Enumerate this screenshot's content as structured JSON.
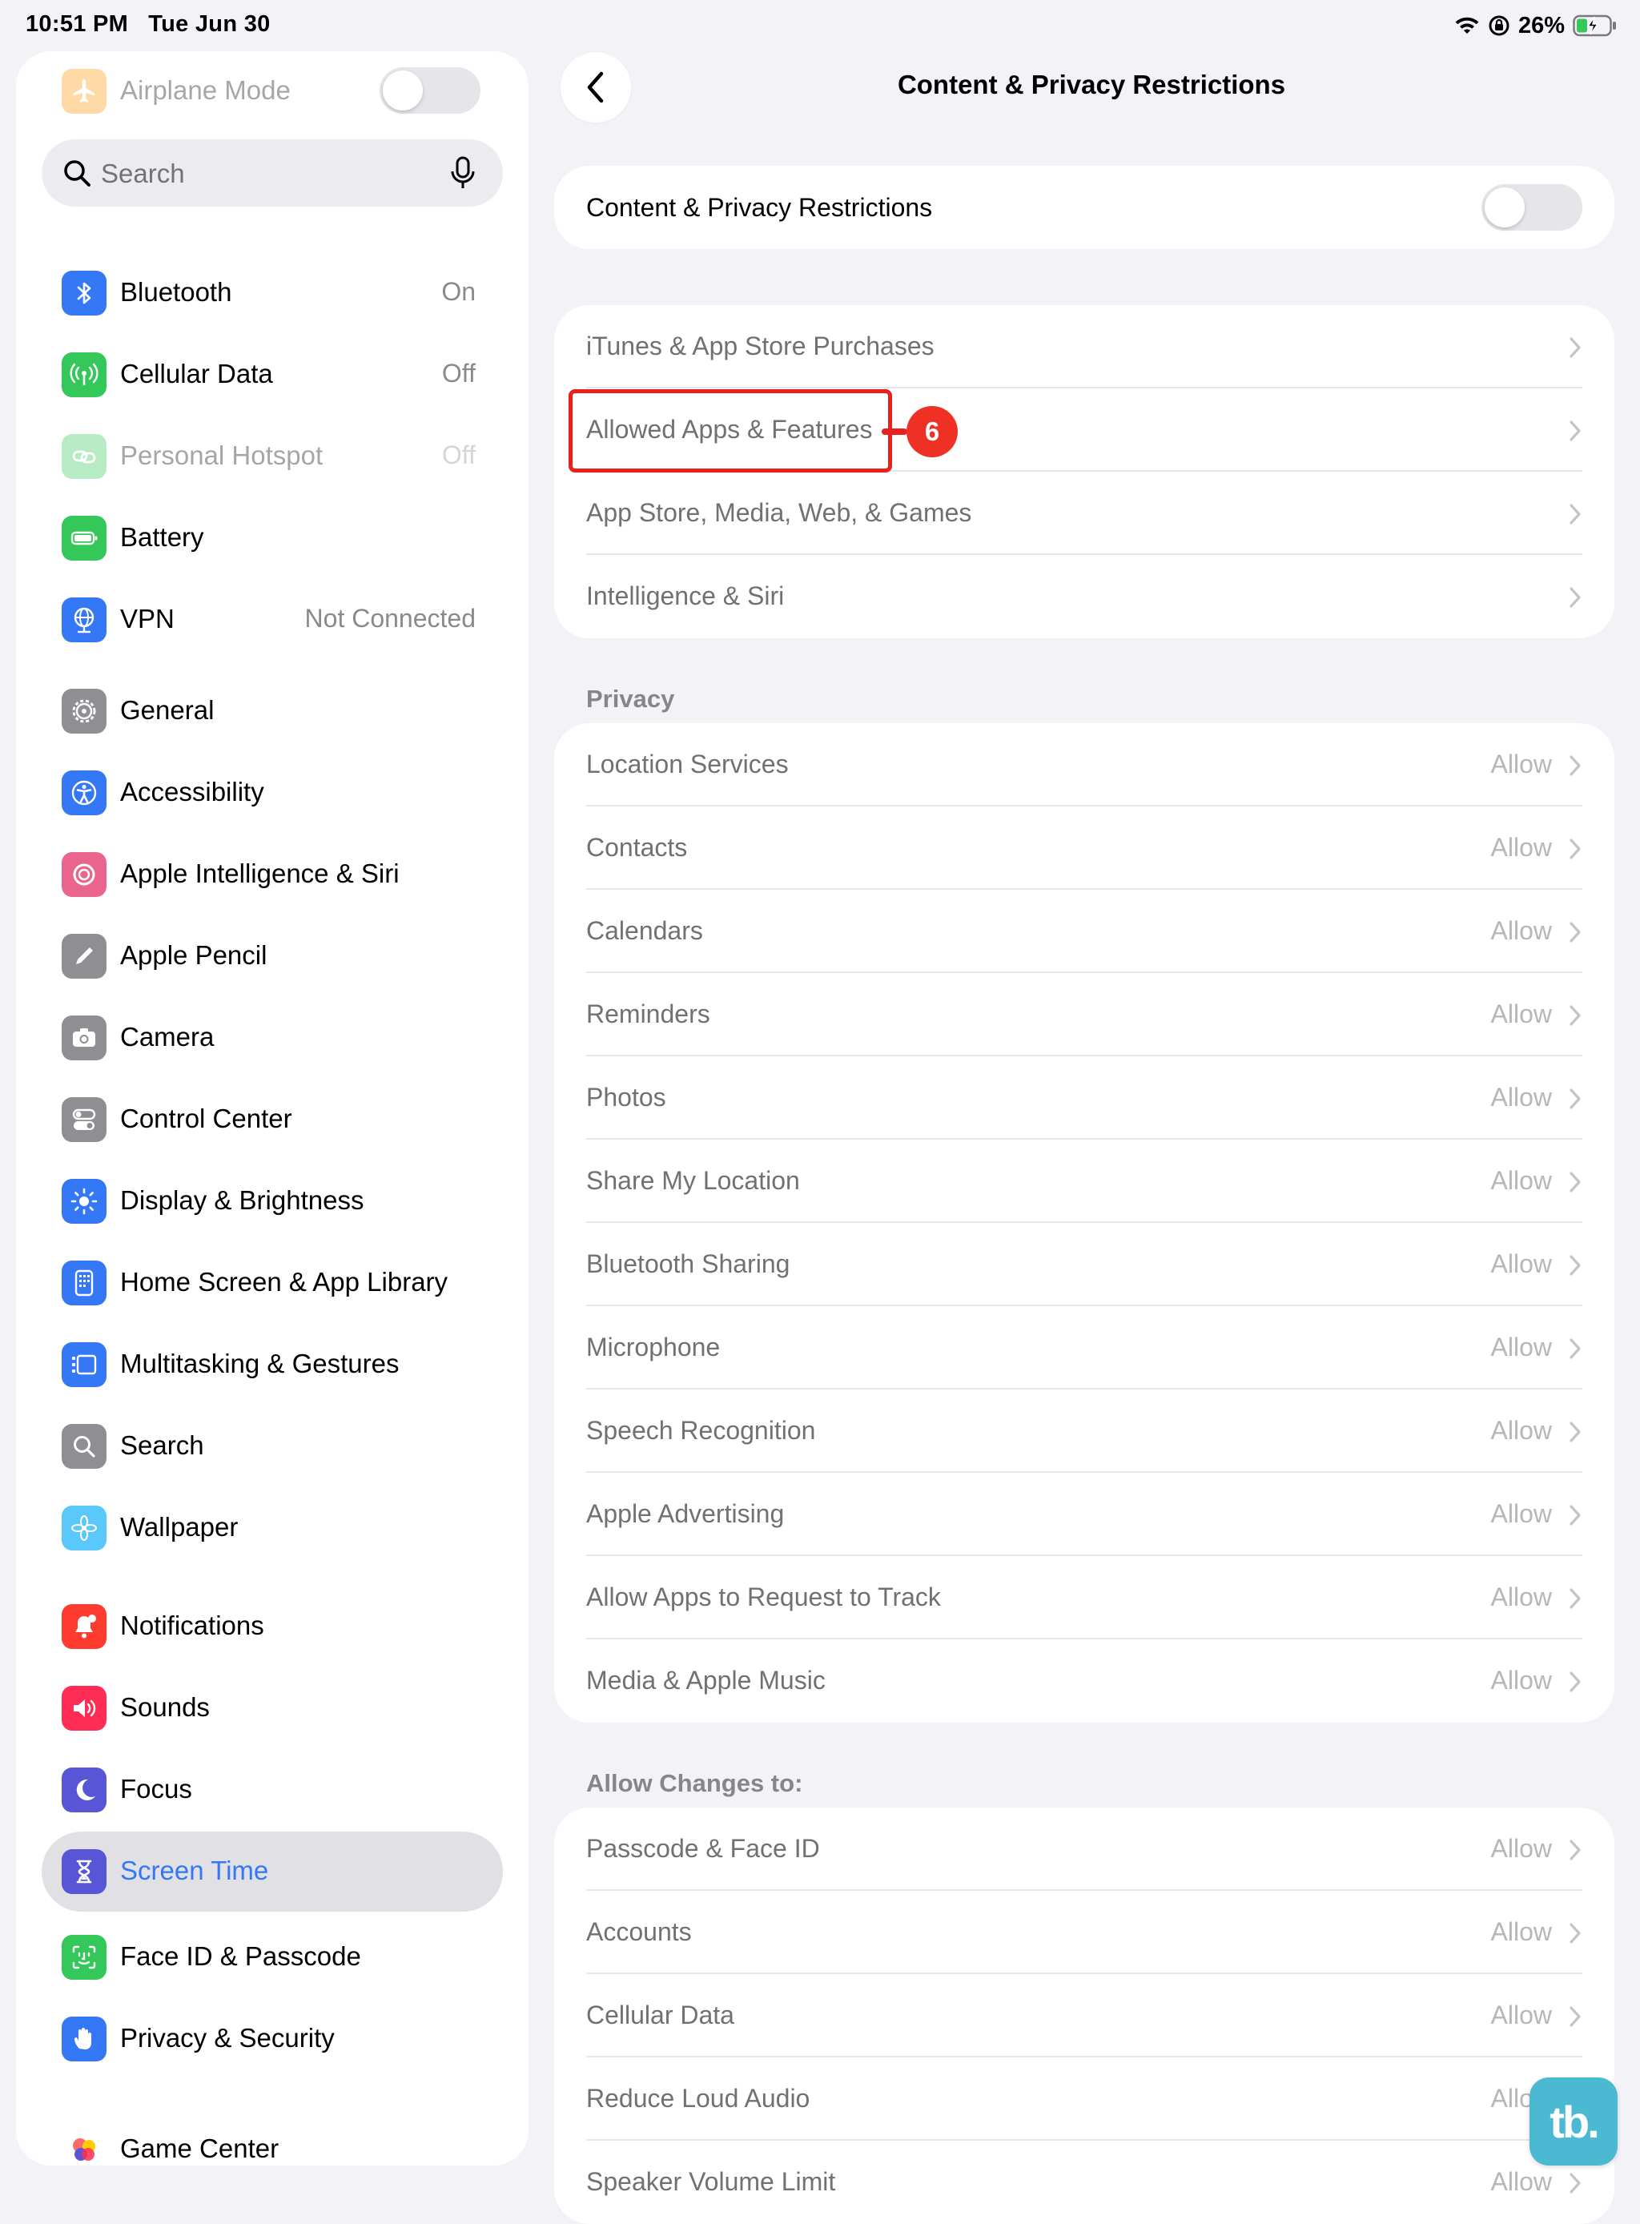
{
  "status_bar": {
    "time": "10:51 PM",
    "date": "Tue Jun 30",
    "battery_percent": "26%",
    "icons": [
      "wifi-icon",
      "orientation-lock-icon",
      "battery-charging-icon"
    ]
  },
  "sidebar": {
    "search_placeholder": "Search",
    "airplane_mode": {
      "label": "Airplane Mode",
      "toggle_on": false,
      "icon": "airplane-icon"
    },
    "groups": [
      [
        {
          "label": "Bluetooth",
          "value": "On",
          "icon": "bluetooth-icon",
          "color": "#3478f6"
        },
        {
          "label": "Cellular Data",
          "value": "Off",
          "icon": "antenna-icon",
          "color": "#34c759"
        },
        {
          "label": "Personal Hotspot",
          "value": "Off",
          "icon": "link-icon",
          "color": "#34c759",
          "dim": true
        },
        {
          "label": "Battery",
          "value": "",
          "icon": "battery-icon",
          "color": "#34c759"
        },
        {
          "label": "VPN",
          "value": "Not Connected",
          "icon": "globe-icon",
          "color": "#3478f6"
        }
      ],
      [
        {
          "label": "General",
          "value": "",
          "icon": "gear-icon",
          "color": "#8e8e93"
        },
        {
          "label": "Accessibility",
          "value": "",
          "icon": "accessibility-icon",
          "color": "#3478f6"
        },
        {
          "label": "Apple Intelligence & Siri",
          "value": "",
          "icon": "apple-intelligence-icon",
          "color": "#e9658e"
        },
        {
          "label": "Apple Pencil",
          "value": "",
          "icon": "pencil-icon",
          "color": "#8e8e93"
        },
        {
          "label": "Camera",
          "value": "",
          "icon": "camera-icon",
          "color": "#8e8e93"
        },
        {
          "label": "Control Center",
          "value": "",
          "icon": "toggles-icon",
          "color": "#8e8e93"
        },
        {
          "label": "Display & Brightness",
          "value": "",
          "icon": "sun-icon",
          "color": "#3478f6"
        },
        {
          "label": "Home Screen & App Library",
          "value": "",
          "icon": "home-screen-icon",
          "color": "#3478f6"
        },
        {
          "label": "Multitasking & Gestures",
          "value": "",
          "icon": "multitasking-icon",
          "color": "#3478f6"
        },
        {
          "label": "Search",
          "value": "",
          "icon": "search-icon",
          "color": "#8e8e93"
        },
        {
          "label": "Wallpaper",
          "value": "",
          "icon": "flower-icon",
          "color": "#5ac8fa"
        }
      ],
      [
        {
          "label": "Notifications",
          "value": "",
          "icon": "bell-icon",
          "color": "#ff3b30"
        },
        {
          "label": "Sounds",
          "value": "",
          "icon": "speaker-icon",
          "color": "#ff2d55"
        },
        {
          "label": "Focus",
          "value": "",
          "icon": "moon-icon",
          "color": "#5856d6"
        },
        {
          "label": "Screen Time",
          "value": "",
          "icon": "hourglass-icon",
          "color": "#5856d6",
          "selected": true
        }
      ],
      [
        {
          "label": "Face ID & Passcode",
          "value": "",
          "icon": "face-id-icon",
          "color": "#34c759"
        },
        {
          "label": "Privacy & Security",
          "value": "",
          "icon": "hand-icon",
          "color": "#3478f6"
        }
      ],
      [
        {
          "label": "Game Center",
          "value": "",
          "icon": "game-center-icon",
          "color": "#ffffff"
        }
      ]
    ]
  },
  "main": {
    "title": "Content & Privacy Restrictions",
    "master_toggle": {
      "label": "Content & Privacy Restrictions",
      "on": false
    },
    "store_group": [
      {
        "label": "iTunes & App Store Purchases",
        "value": ""
      },
      {
        "label": "Allowed Apps & Features",
        "value": ""
      },
      {
        "label": "App Store, Media, Web, & Games",
        "value": ""
      },
      {
        "label": "Intelligence & Siri",
        "value": ""
      }
    ],
    "privacy_header": "Privacy",
    "privacy_group": [
      {
        "label": "Location Services",
        "value": "Allow"
      },
      {
        "label": "Contacts",
        "value": "Allow"
      },
      {
        "label": "Calendars",
        "value": "Allow"
      },
      {
        "label": "Reminders",
        "value": "Allow"
      },
      {
        "label": "Photos",
        "value": "Allow"
      },
      {
        "label": "Share My Location",
        "value": "Allow"
      },
      {
        "label": "Bluetooth Sharing",
        "value": "Allow"
      },
      {
        "label": "Microphone",
        "value": "Allow"
      },
      {
        "label": "Speech Recognition",
        "value": "Allow"
      },
      {
        "label": "Apple Advertising",
        "value": "Allow"
      },
      {
        "label": "Allow Apps to Request to Track",
        "value": "Allow"
      },
      {
        "label": "Media & Apple Music",
        "value": "Allow"
      }
    ],
    "changes_header": "Allow Changes to:",
    "changes_group": [
      {
        "label": "Passcode & Face ID",
        "value": "Allow"
      },
      {
        "label": "Accounts",
        "value": "Allow"
      },
      {
        "label": "Cellular Data",
        "value": "Allow"
      },
      {
        "label": "Reduce Loud Audio",
        "value": "Allow"
      },
      {
        "label": "Speaker Volume Limit",
        "value": "Allow"
      }
    ]
  },
  "annotation": {
    "step_number": "6",
    "color": "#e8211f"
  },
  "watermark": {
    "text": "tb.",
    "color": "#4ab9d1"
  }
}
